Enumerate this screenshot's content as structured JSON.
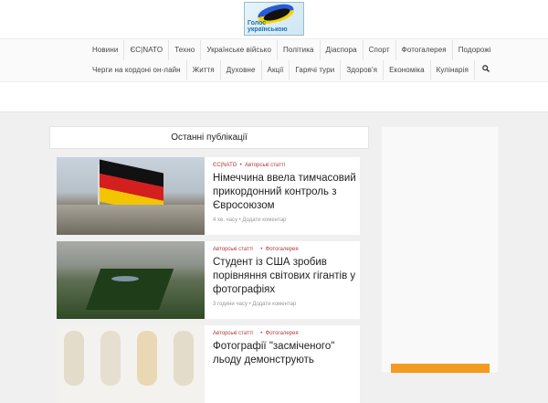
{
  "logo": {
    "text": "Голос українською"
  },
  "nav": {
    "row1": [
      "Новини",
      "ЄС|NATO",
      "Техно",
      "Українське військо",
      "Політика",
      "Діаспора",
      "Спорт",
      "Фотогалерея",
      "Подорожі"
    ],
    "row2": [
      "Черги на кордоні он-лайн",
      "Життя",
      "Духовне",
      "Акції",
      "Гарячі тури",
      "Здоров'я",
      "Економіка",
      "Кулінарія"
    ],
    "search_icon": "search-icon"
  },
  "main": {
    "heading": "Останні публікації",
    "posts": [
      {
        "cats": "ЄС|NATO  •  Авторські статті",
        "title": "Німеччина ввела тимчасовий прикордонний контроль з Євросоюзом",
        "meta": "4 хв. часу  •  Додати коментар"
      },
      {
        "cats": "Авторські статті     •  Фотогалерея",
        "title": "Студент із США зробив порівняння світових гігантів у фотографіях",
        "meta": "3 години часу  •  Додати коментар"
      },
      {
        "cats": "Авторські статті     •  Фотогалерея",
        "title": "Фотографії \"засміченого\" льоду демонструють",
        "meta": ""
      }
    ]
  },
  "colors": {
    "accent": "#b0393b",
    "sidebar_bar": "#f39b20"
  }
}
